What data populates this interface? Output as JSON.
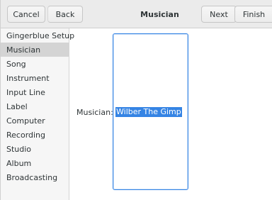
{
  "header": {
    "cancel_label": "Cancel",
    "back_label": "Back",
    "title": "Musician",
    "next_label": "Next",
    "finish_label": "Finish"
  },
  "sidebar": {
    "items": [
      {
        "label": "Gingerblue Setup",
        "selected": false
      },
      {
        "label": "Musician",
        "selected": true
      },
      {
        "label": "Song",
        "selected": false
      },
      {
        "label": "Instrument",
        "selected": false
      },
      {
        "label": "Input Line",
        "selected": false
      },
      {
        "label": "Label",
        "selected": false
      },
      {
        "label": "Computer",
        "selected": false
      },
      {
        "label": "Recording",
        "selected": false
      },
      {
        "label": "Studio",
        "selected": false
      },
      {
        "label": "Album",
        "selected": false
      },
      {
        "label": "Broadcasting",
        "selected": false
      }
    ]
  },
  "main": {
    "field_label": "Musician:",
    "field_value": "Wilber The Gimp"
  },
  "colors": {
    "accent": "#3584e4",
    "selected_row": "#d4d4d4",
    "headerbar": "#ebebeb"
  }
}
